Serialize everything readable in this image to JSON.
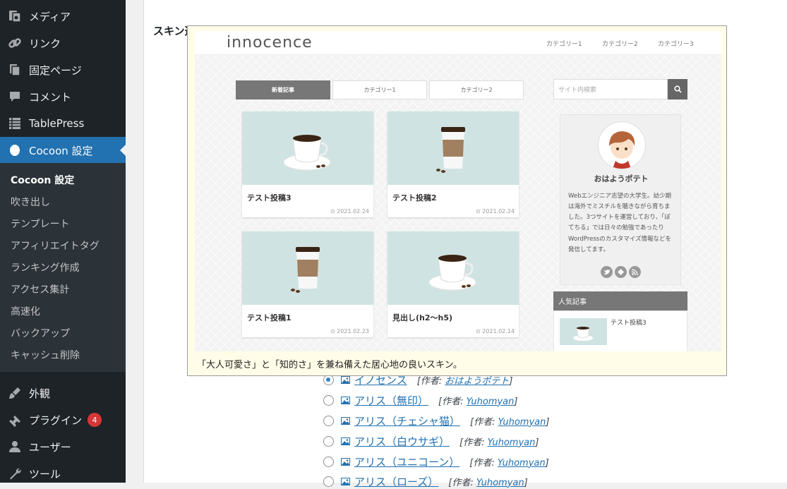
{
  "sidebar": {
    "items": [
      {
        "label": "メディア",
        "icon": "media-icon"
      },
      {
        "label": "リンク",
        "icon": "link-icon"
      },
      {
        "label": "固定ページ",
        "icon": "page-icon"
      },
      {
        "label": "コメント",
        "icon": "comment-icon"
      },
      {
        "label": "TablePress",
        "icon": "table-icon"
      },
      {
        "label": "Cocoon 設定",
        "icon": "cocoon-icon",
        "current": true
      }
    ],
    "submenu": [
      "Cocoon 設定",
      "吹き出し",
      "テンプレート",
      "アフィリエイトタグ",
      "ランキング作成",
      "アクセス集計",
      "高速化",
      "バックアップ",
      "キャッシュ削除"
    ],
    "lower_items": [
      {
        "label": "外観",
        "icon": "appearance-icon"
      },
      {
        "label": "プラグイン",
        "icon": "plugin-icon",
        "badge": "4"
      },
      {
        "label": "ユーザー",
        "icon": "user-icon"
      },
      {
        "label": "ツール",
        "icon": "tool-icon"
      }
    ]
  },
  "main": {
    "section_label": "スキン選択",
    "skins": [
      {
        "name": "イノセンス",
        "author_prefix": "[作者: ",
        "author": "おはようポテト",
        "author_suffix": "]",
        "checked": true
      },
      {
        "name": "アリス（無印）",
        "author_prefix": "[作者: ",
        "author": "Yuhomyan",
        "author_suffix": "]",
        "checked": false
      },
      {
        "name": "アリス（チェシャ猫）",
        "author_prefix": "[作者: ",
        "author": "Yuhomyan",
        "author_suffix": "]",
        "checked": false
      },
      {
        "name": "アリス（白ウサギ）",
        "author_prefix": "[作者: ",
        "author": "Yuhomyan",
        "author_suffix": "]",
        "checked": false
      },
      {
        "name": "アリス（ユニコーン）",
        "author_prefix": "[作者: ",
        "author": "Yuhomyan",
        "author_suffix": "]",
        "checked": false
      },
      {
        "name": "アリス（ローズ）",
        "author_prefix": "[作者: ",
        "author": "Yuhomyan",
        "author_suffix": "]",
        "checked": false
      }
    ]
  },
  "preview": {
    "caption": "「大人可愛さ」と「知的さ」を兼ね備えた居心地の良いスキン。",
    "logo": "innocence",
    "nav": [
      "カテゴリー1",
      "カテゴリー2",
      "カテゴリー3"
    ],
    "tabs": [
      "新着記事",
      "カテゴリー1",
      "カテゴリー2"
    ],
    "cards": [
      {
        "title": "テスト投稿3",
        "date": "2021.02.24",
        "image": "coffee-cup"
      },
      {
        "title": "テスト投稿2",
        "date": "2021.02.24",
        "image": "takeout-cup"
      },
      {
        "title": "テスト投稿1",
        "date": "2021.02.23",
        "image": "takeout-cup"
      },
      {
        "title": "見出し(h2〜h5)",
        "date": "2021.02.14",
        "image": "coffee-cup"
      }
    ],
    "search_placeholder": "サイト内検索",
    "profile": {
      "name": "おはようポテト",
      "bio": "Webエンジニア志望の大学生。幼少期は海外でミスチルを聴きながら育ちました。3つサイトを運営しており、「ぽてちる」では日々の勉強であったりWordPressのカスタマイズ情報などを発信してます。"
    },
    "popular": {
      "heading": "人気記事",
      "item_title": "テスト投稿3"
    }
  },
  "colors": {
    "sidebar_bg": "#1d2327",
    "submenu_bg": "#2c3338",
    "accent": "#2271b1",
    "badge": "#d63638",
    "preview_bg": "#fffde8"
  }
}
